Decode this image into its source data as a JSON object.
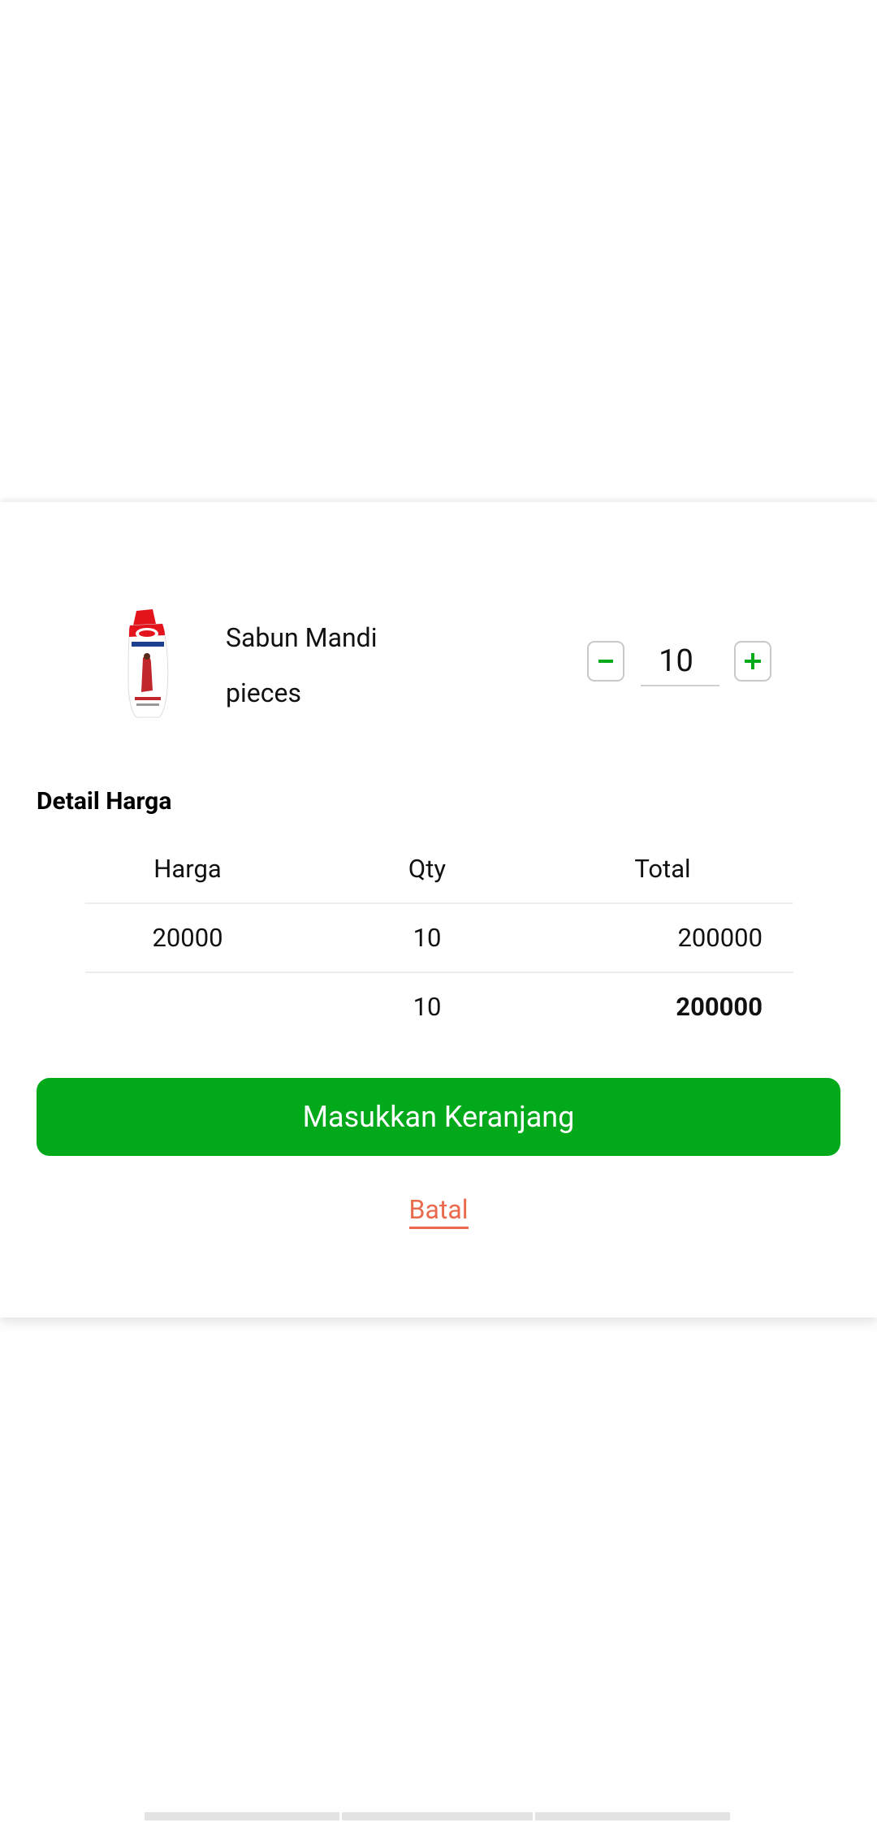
{
  "product": {
    "name": "Sabun Mandi",
    "unit": "pieces",
    "image_icon": "soap-bottle-icon"
  },
  "quantity": {
    "value": "10",
    "decrement_icon": "minus-icon",
    "increment_icon": "plus-icon"
  },
  "price_detail": {
    "title": "Detail Harga",
    "headers": [
      "Harga",
      "Qty",
      "Total"
    ],
    "row": {
      "harga": "20000",
      "qty": "10",
      "total": "200000"
    },
    "summary": {
      "qty": "10",
      "total": "200000"
    }
  },
  "actions": {
    "add_to_cart_label": "Masukkan Keranjang",
    "cancel_label": "Batal"
  },
  "colors": {
    "primary": "#02a91a",
    "cancel": "#ea6a4e"
  }
}
